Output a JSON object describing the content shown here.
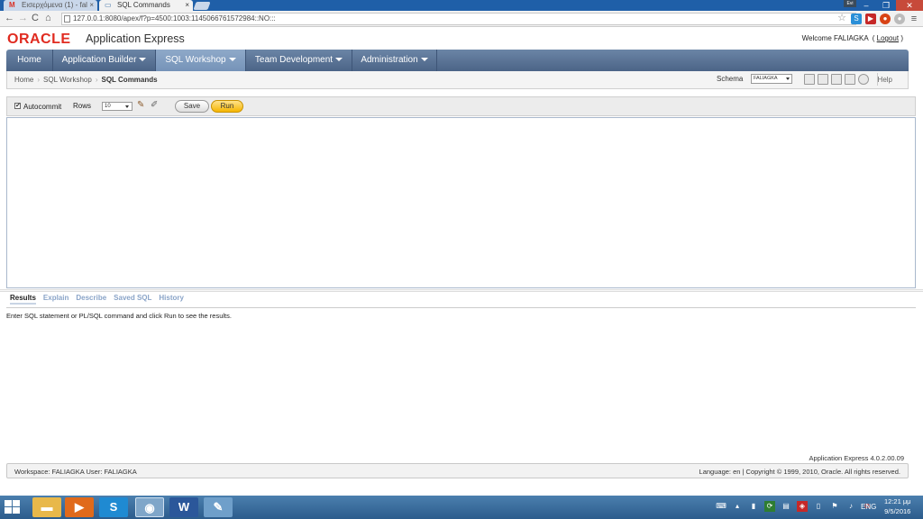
{
  "browser": {
    "tabs": [
      {
        "label": "Εισερχόμενα (1) - fal",
        "icon": "M",
        "active": false
      },
      {
        "label": "SQL Commands",
        "icon": "▭",
        "active": true
      }
    ],
    "url": "127.0.0.1:8080/apex/f?p=4500:1003:1145066761572984::NO:::",
    "user_chip": "Evi"
  },
  "header": {
    "logo": "ORACLE",
    "app_name": "Application Express",
    "welcome_text": "Welcome FALIAGKA",
    "logout_open": "(",
    "logout_label": "Logout",
    "logout_close": ")"
  },
  "main_nav": [
    {
      "label": "Home",
      "dropdown": false
    },
    {
      "label": "Application Builder",
      "dropdown": true
    },
    {
      "label": "SQL Workshop",
      "dropdown": true,
      "selected": true
    },
    {
      "label": "Team Development",
      "dropdown": true
    },
    {
      "label": "Administration",
      "dropdown": true
    }
  ],
  "breadcrumb": {
    "items": [
      "Home",
      "SQL Workshop",
      "SQL Commands"
    ],
    "schema_label": "Schema",
    "schema_value": "FALIAGKA",
    "help_label": "Help"
  },
  "command_bar": {
    "autocommit_label": "Autocommit",
    "autocommit_checked": true,
    "autocommit_mark": "✔",
    "rows_label": "Rows",
    "rows_value": "10",
    "save_label": "Save",
    "run_label": "Run"
  },
  "editor": {
    "value": ""
  },
  "results": {
    "tabs": [
      "Results",
      "Explain",
      "Describe",
      "Saved SQL",
      "History"
    ],
    "selected_tab": "Results",
    "message": "Enter SQL statement or PL/SQL command and click Run to see the results."
  },
  "footer": {
    "version": "Application Express 4.0.2.00.09",
    "workspace": "Workspace: FALIAGKA User: FALIAGKA",
    "language_copyright": "Language: en | Copyright © 1999, 2010, Oracle. All rights reserved."
  },
  "taskbar": {
    "tray_language": "ENG",
    "time": "12:21 μμ",
    "date": "9/5/2016"
  },
  "colors": {
    "oracle_red": "#e02b20",
    "nav_blue": "#4b6487",
    "run_button": "#f5b500",
    "taskbar": "#2c5c8c"
  }
}
